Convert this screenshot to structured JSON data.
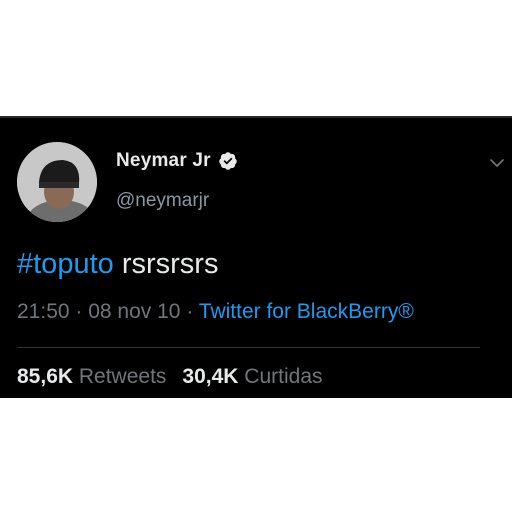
{
  "tweet": {
    "author": {
      "name": "Neymar Jr",
      "handle": "@neymarjr",
      "verified": true
    },
    "text": {
      "hashtag": "#toputo",
      "rest": " rsrsrsrs"
    },
    "meta": {
      "time": "21:50",
      "separator": " · ",
      "date": "08 nov 10",
      "source": "Twitter for BlackBerry®"
    },
    "stats": [
      {
        "count": "85,6K",
        "label": " Retweets"
      },
      {
        "count": "30,4K",
        "label": " Curtidas"
      }
    ]
  },
  "icons": {
    "verified": "verified-badge-icon",
    "menu": "chevron-down-icon"
  },
  "colors": {
    "background": "#000000",
    "accent": "#1d9bf0",
    "primary_text": "#e7e9ea",
    "secondary_text": "#71767b"
  }
}
